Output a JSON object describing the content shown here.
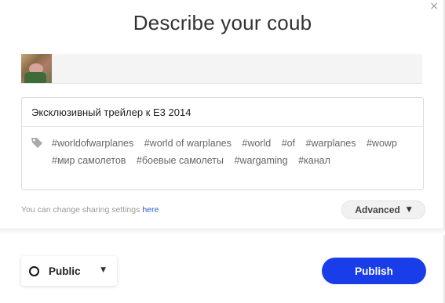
{
  "dialog": {
    "close_glyph": "×",
    "title": "Describe your coub"
  },
  "description": {
    "title_value": "Эксклюзивный трейлер к E3 2014",
    "tags": [
      "#worldofwarplanes",
      "#world of warplanes",
      "#world",
      "#of",
      "#warplanes",
      "#wowp",
      "#мир самолетов",
      "#боевые самолеты",
      "#wargaming",
      "#канал"
    ]
  },
  "sharing": {
    "note_text": "You can change sharing settings",
    "link_text": "here"
  },
  "advanced": {
    "label": "Advanced",
    "caret": "▼"
  },
  "privacy": {
    "label": "Public",
    "caret": "▼"
  },
  "publish": {
    "label": "Publish"
  },
  "colors": {
    "accent": "#1a3dea",
    "link": "#2a5fd6"
  }
}
